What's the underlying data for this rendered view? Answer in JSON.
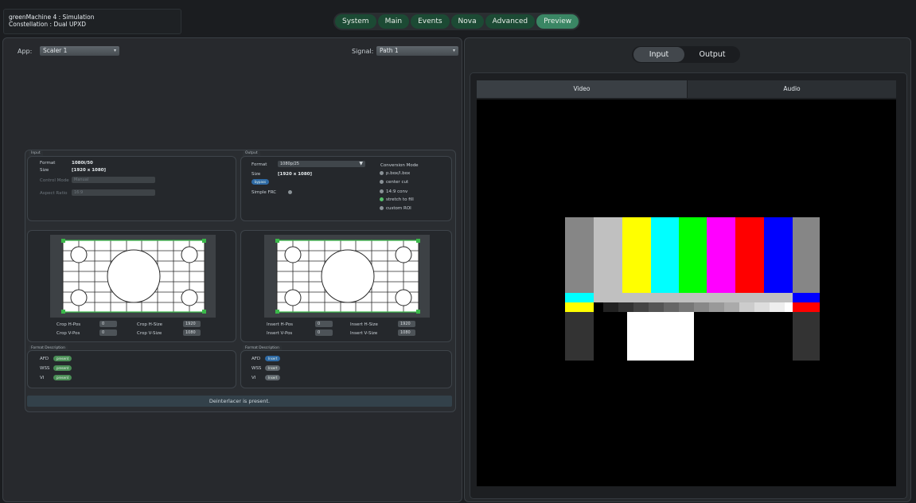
{
  "window": {
    "line1": "greenMachine 4 : Simulation",
    "line2": "Constellation : Dual UPXD"
  },
  "nav": [
    {
      "label": "System",
      "active": false
    },
    {
      "label": "Main",
      "active": false
    },
    {
      "label": "Events",
      "active": false
    },
    {
      "label": "Nova",
      "active": false
    },
    {
      "label": "Advanced",
      "active": false
    },
    {
      "label": "Preview",
      "active": true
    }
  ],
  "left": {
    "app_label": "App:",
    "app_value": "Scaler 1",
    "signal_label": "Signal:",
    "signal_value": "Path 1",
    "input": {
      "header": "Input",
      "format_label": "Format",
      "format_value": "1080i/50",
      "size_label": "Size",
      "size_value": "[1920 x 1080]",
      "control_mode_label": "Control Mode",
      "control_mode_value": "Manual",
      "aspect_ratio_label": "Aspect Ratio",
      "aspect_ratio_value": "16:9"
    },
    "output": {
      "header": "Output",
      "format_label": "Format",
      "format_value": "1080p/25",
      "size_label": "Size",
      "size_value": "[1920 x 1080]",
      "bypass_label": "bypass",
      "simple_frc_label": "Simple FRC",
      "conversion_label": "Conversion Mode",
      "conversion_options": [
        {
          "label": "p.box/l.box",
          "on": false
        },
        {
          "label": "center cut",
          "on": false
        },
        {
          "label": "14:9 conv",
          "on": false
        },
        {
          "label": "stretch to fill",
          "on": true
        },
        {
          "label": "custom ROI",
          "on": false
        }
      ]
    },
    "crop": {
      "hpos_label": "Crop H-Pos",
      "hpos_value": "0",
      "vpos_label": "Crop V-Pos",
      "vpos_value": "0",
      "hsize_label": "Crop H-Size",
      "hsize_value": "1920",
      "vsize_label": "Crop V-Size",
      "vsize_value": "1080"
    },
    "insert": {
      "hpos_label": "Insert H-Pos",
      "hpos_value": "0",
      "vpos_label": "Insert V-Pos",
      "vpos_value": "0",
      "hsize_label": "Insert H-Size",
      "hsize_value": "1920",
      "vsize_label": "Insert V-Size",
      "vsize_value": "1080"
    },
    "format_desc_in": {
      "header": "Format Description",
      "rows": [
        {
          "label": "AFD",
          "badge": "present"
        },
        {
          "label": "WSS",
          "badge": "present"
        },
        {
          "label": "VI",
          "badge": "present"
        }
      ]
    },
    "format_desc_out": {
      "header": "Format Description",
      "rows": [
        {
          "label": "AFD",
          "badge": "Insert"
        },
        {
          "label": "WSS",
          "badge": "Insert"
        },
        {
          "label": "VI",
          "badge": "Insert"
        }
      ]
    },
    "status": "Deinterlacer is present."
  },
  "right": {
    "tabs": [
      {
        "label": "Input",
        "active": true
      },
      {
        "label": "Output",
        "active": false
      }
    ],
    "subtabs": [
      {
        "label": "Video",
        "active": true
      },
      {
        "label": "Audio",
        "active": false
      }
    ]
  },
  "colors": {
    "nav_green": "#1c4a34",
    "nav_active": "#3a8664",
    "panel_bg": "#27292d"
  }
}
